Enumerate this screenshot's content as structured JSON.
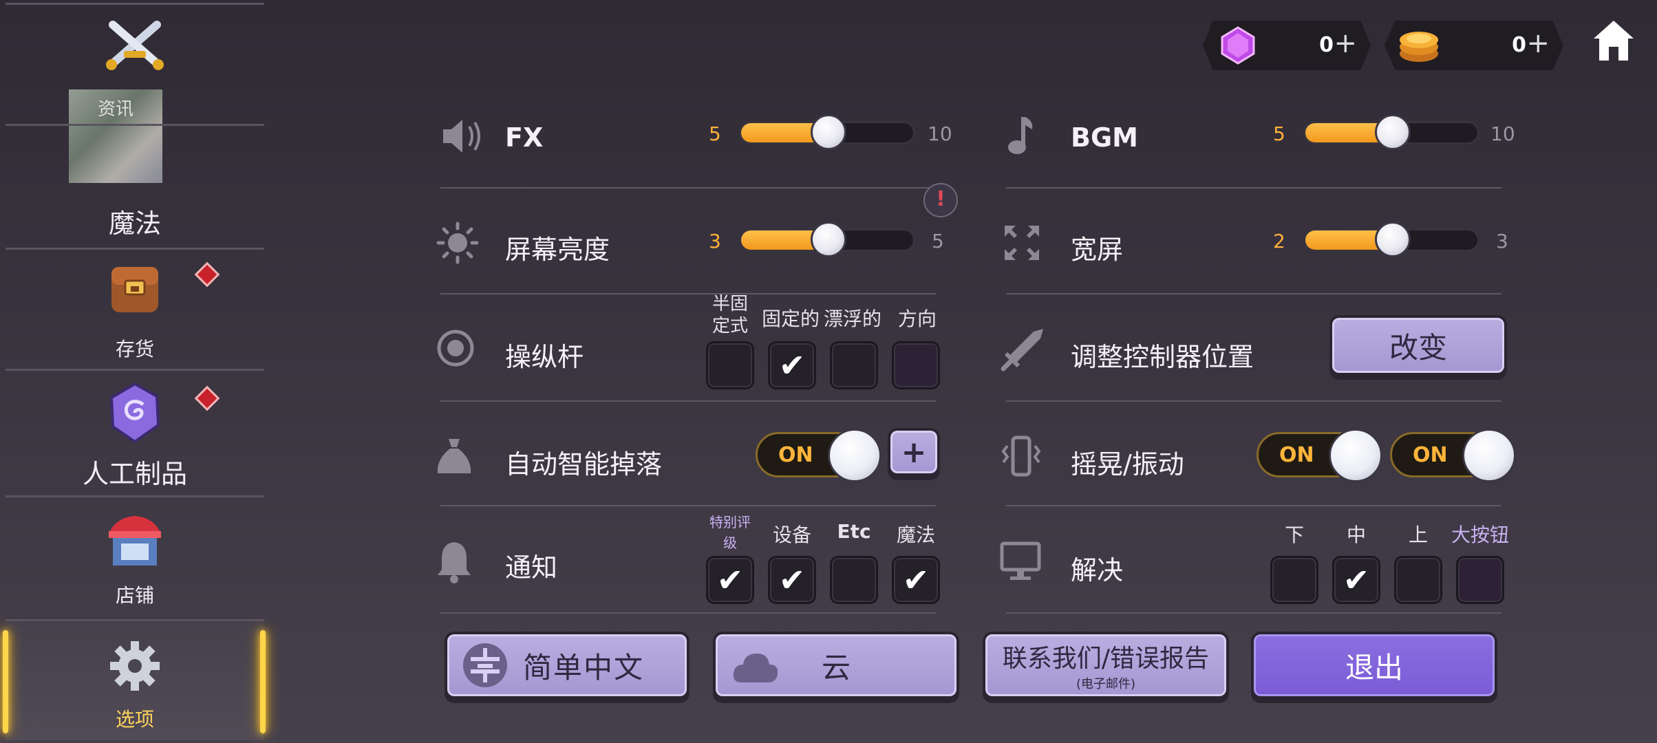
{
  "sidebar": {
    "items": [
      {
        "label": "资讯"
      },
      {
        "label": "魔法"
      },
      {
        "label": "存货"
      },
      {
        "label": "人工制品"
      },
      {
        "label": "店铺"
      },
      {
        "label": "选项"
      }
    ]
  },
  "currency": {
    "gems": {
      "amount": "0",
      "plus": "+"
    },
    "gold": {
      "amount": "0",
      "plus": "+"
    }
  },
  "settings": {
    "fx": {
      "label": "FX",
      "value": "5",
      "max": "10",
      "level": 0.5
    },
    "bgm": {
      "label": "BGM",
      "value": "5",
      "max": "10",
      "level": 0.5
    },
    "brightness": {
      "label": "屏幕亮度",
      "value": "3",
      "max": "5",
      "level": 0.5
    },
    "widescreen": {
      "label": "宽屏",
      "value": "2",
      "max": "3",
      "level": 0.5
    },
    "alert": "!",
    "joystick": {
      "label": "操纵杆",
      "options": [
        {
          "label": "半固定式",
          "checked": false
        },
        {
          "label": "固定的",
          "checked": true
        },
        {
          "label": "漂浮的",
          "checked": false
        },
        {
          "label": "方向",
          "checked": false
        }
      ]
    },
    "controller_position": {
      "label": "调整控制器位置",
      "button": "改变"
    },
    "auto_loot": {
      "label": "自动智能掉落",
      "toggle": "ON",
      "plus": "+"
    },
    "shake": {
      "label": "摇晃/振动",
      "toggle1": "ON",
      "toggle2": "ON"
    },
    "notification": {
      "label": "通知",
      "options": [
        {
          "label": "特别评级",
          "checked": true
        },
        {
          "label": "设备",
          "checked": true
        },
        {
          "label": "Etc",
          "checked": false
        },
        {
          "label": "魔法",
          "checked": true
        }
      ]
    },
    "resolution": {
      "label": "解决",
      "options": [
        {
          "label": "下",
          "checked": false
        },
        {
          "label": "中",
          "checked": true
        },
        {
          "label": "上",
          "checked": false
        },
        {
          "label": "大按钮",
          "checked": false
        }
      ]
    }
  },
  "buttons": {
    "language": "简单中文",
    "cloud": "云",
    "contact": "联系我们/错误报告",
    "contact_sub": "(电子邮件)",
    "exit": "退出"
  },
  "colors": {
    "accent_orange": "#ffb13c",
    "button_purple": "#a99bd6",
    "exit_purple": "#7e60d8",
    "highlight_gold": "#ffd54a"
  }
}
